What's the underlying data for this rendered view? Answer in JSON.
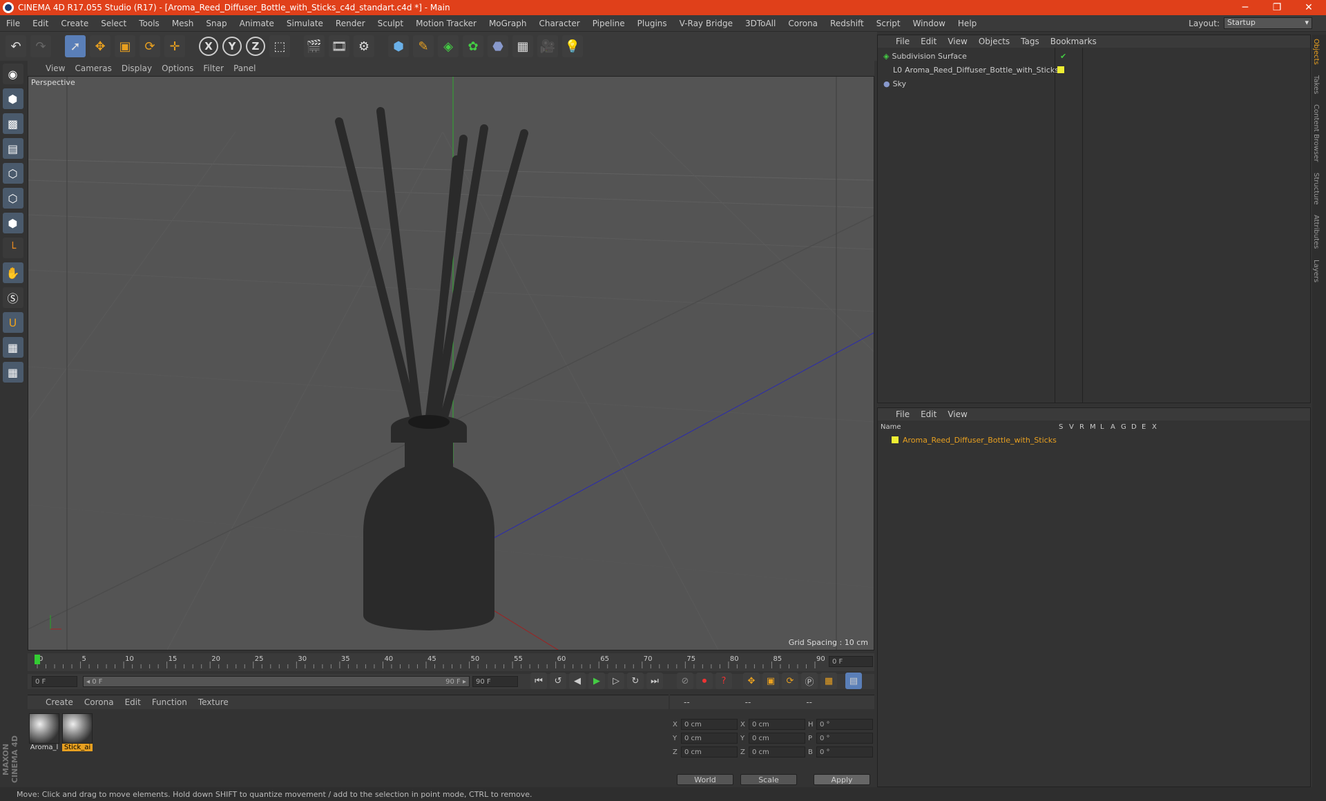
{
  "window": {
    "title": "CINEMA 4D R17.055 Studio (R17) - [Aroma_Reed_Diffuser_Bottle_with_Sticks_c4d_standart.c4d *] - Main",
    "minimize": "─",
    "maximize": "❐",
    "close": "✕"
  },
  "menu": [
    "File",
    "Edit",
    "Create",
    "Select",
    "Tools",
    "Mesh",
    "Snap",
    "Animate",
    "Simulate",
    "Render",
    "Sculpt",
    "Motion Tracker",
    "MoGraph",
    "Character",
    "Pipeline",
    "Plugins",
    "V-Ray Bridge",
    "3DToAll",
    "Corona",
    "Redshift",
    "Script",
    "Window",
    "Help"
  ],
  "layout": {
    "label": "Layout:",
    "value": "Startup"
  },
  "viewport": {
    "menu": [
      "View",
      "Cameras",
      "Display",
      "Options",
      "Filter",
      "Panel"
    ],
    "label": "Perspective",
    "grid_spacing": "Grid Spacing : 10 cm"
  },
  "timeline": {
    "ticks": [
      "0",
      "5",
      "10",
      "15",
      "20",
      "25",
      "30",
      "35",
      "40",
      "45",
      "50",
      "55",
      "60",
      "65",
      "70",
      "75",
      "80",
      "85",
      "90"
    ],
    "frame_field": "0 F",
    "start": "0 F",
    "range_start": "◂ 0 F",
    "range_end": "90 F ▸",
    "end": "90 F"
  },
  "materials": {
    "menu": [
      "Create",
      "Corona",
      "Edit",
      "Function",
      "Texture"
    ],
    "items": [
      {
        "label": "Aroma_l"
      },
      {
        "label": "Stick_ai"
      }
    ]
  },
  "attributes": {
    "headers": [
      "--",
      "--",
      "--"
    ],
    "rows": [
      {
        "a": "X",
        "v1": "0 cm",
        "b": "X",
        "v2": "0 cm",
        "c": "H",
        "v3": "0 °"
      },
      {
        "a": "Y",
        "v1": "0 cm",
        "b": "Y",
        "v2": "0 cm",
        "c": "P",
        "v3": "0 °"
      },
      {
        "a": "Z",
        "v1": "0 cm",
        "b": "Z",
        "v2": "0 cm",
        "c": "B",
        "v3": "0 °"
      }
    ],
    "world": "World",
    "scale": "Scale",
    "apply": "Apply"
  },
  "objects": {
    "menu": [
      "File",
      "Edit",
      "View",
      "Objects",
      "Tags",
      "Bookmarks"
    ],
    "items": [
      {
        "name": "Subdivision Surface"
      },
      {
        "name": "Aroma_Reed_Diffuser_Bottle_with_Sticks"
      },
      {
        "name": "Sky"
      }
    ]
  },
  "layers": {
    "menu": [
      "File",
      "Edit",
      "View"
    ],
    "cols": [
      "Name",
      "S",
      "V",
      "R",
      "M",
      "L",
      "A",
      "G",
      "D",
      "E",
      "X"
    ],
    "items": [
      {
        "name": "Aroma_Reed_Diffuser_Bottle_with_Sticks"
      }
    ]
  },
  "right_tabs": [
    "Objects",
    "Takes",
    "Content Browser",
    "Structure",
    "Attributes",
    "Layers"
  ],
  "status": "Move: Click and drag to move elements. Hold down SHIFT to quantize movement / add to the selection in point mode, CTRL to remove.",
  "brand": "MAXON CINEMA 4D"
}
